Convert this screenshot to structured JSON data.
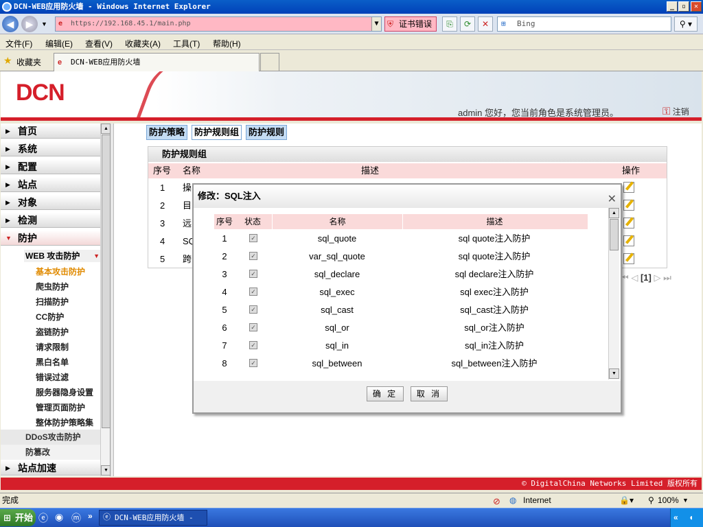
{
  "window": {
    "title": "DCN-WEB应用防火墙 - Windows Internet Explorer",
    "buttons": [
      "_",
      "▫",
      "✕"
    ]
  },
  "address": {
    "url": "https://192.168.45.1/main.php",
    "cert_error": "证书错误",
    "search_placeholder": "Bing"
  },
  "menu": [
    "文件(F)",
    "编辑(E)",
    "查看(V)",
    "收藏夹(A)",
    "工具(T)",
    "帮助(H)"
  ],
  "favorites": {
    "label": "收藏夹",
    "tab_title": "DCN-WEB应用防火墙"
  },
  "header": {
    "logo": "DCN",
    "user_info": "admin 您好，您当前角色是系统管理员。",
    "logout": "注销"
  },
  "sidebar": {
    "items": [
      "首页",
      "系统",
      "配置",
      "站点",
      "对象",
      "检测",
      "防护"
    ],
    "web_attack": "WEB 攻击防护",
    "subs": [
      "基本攻击防护",
      "爬虫防护",
      "扫描防护",
      "CC防护",
      "盗链防护",
      "请求限制",
      "黑白名单",
      "错误过滤",
      "服务器隐身设置",
      "管理页面防护",
      "整体防护策略集"
    ],
    "ddos": "DDoS攻击防护",
    "tamper": "防篡改",
    "accel": "站点加速"
  },
  "tabs": [
    "防护策略",
    "防护规则组",
    "防护规则"
  ],
  "panel": {
    "title": "防护规则组",
    "cols": [
      "序号",
      "名称",
      "描述",
      "操作"
    ],
    "rows": [
      {
        "no": "1",
        "name": "操"
      },
      {
        "no": "2",
        "name": "目"
      },
      {
        "no": "3",
        "name": "远"
      },
      {
        "no": "4",
        "name": "SQ"
      },
      {
        "no": "5",
        "name": "跨"
      }
    ]
  },
  "pager": {
    "current": "[1]"
  },
  "footer": "© DigitalChina Networks Limited 版权所有",
  "dialog": {
    "title": "修改：SQL注入",
    "cols": [
      "序号",
      "状态",
      "名称",
      "描述"
    ],
    "rows": [
      {
        "no": "1",
        "name": "sql_quote",
        "desc": "sql quote注入防护"
      },
      {
        "no": "2",
        "name": "var_sql_quote",
        "desc": "sql quote注入防护"
      },
      {
        "no": "3",
        "name": "sql_declare",
        "desc": "sql declare注入防护"
      },
      {
        "no": "4",
        "name": "sql_exec",
        "desc": "sql exec注入防护"
      },
      {
        "no": "5",
        "name": "sql_cast",
        "desc": "sql_cast注入防护"
      },
      {
        "no": "6",
        "name": "sql_or",
        "desc": "sql_or注入防护"
      },
      {
        "no": "7",
        "name": "sql_in",
        "desc": "sql_in注入防护"
      },
      {
        "no": "8",
        "name": "sql_between",
        "desc": "sql_between注入防护"
      }
    ],
    "ok": "确 定",
    "cancel": "取 消"
  },
  "status": {
    "text": "完成",
    "zone": "Internet",
    "zoom": "100%"
  },
  "taskbar": {
    "start": "开始",
    "task": "DCN-WEB应用防火墙 - ..."
  }
}
